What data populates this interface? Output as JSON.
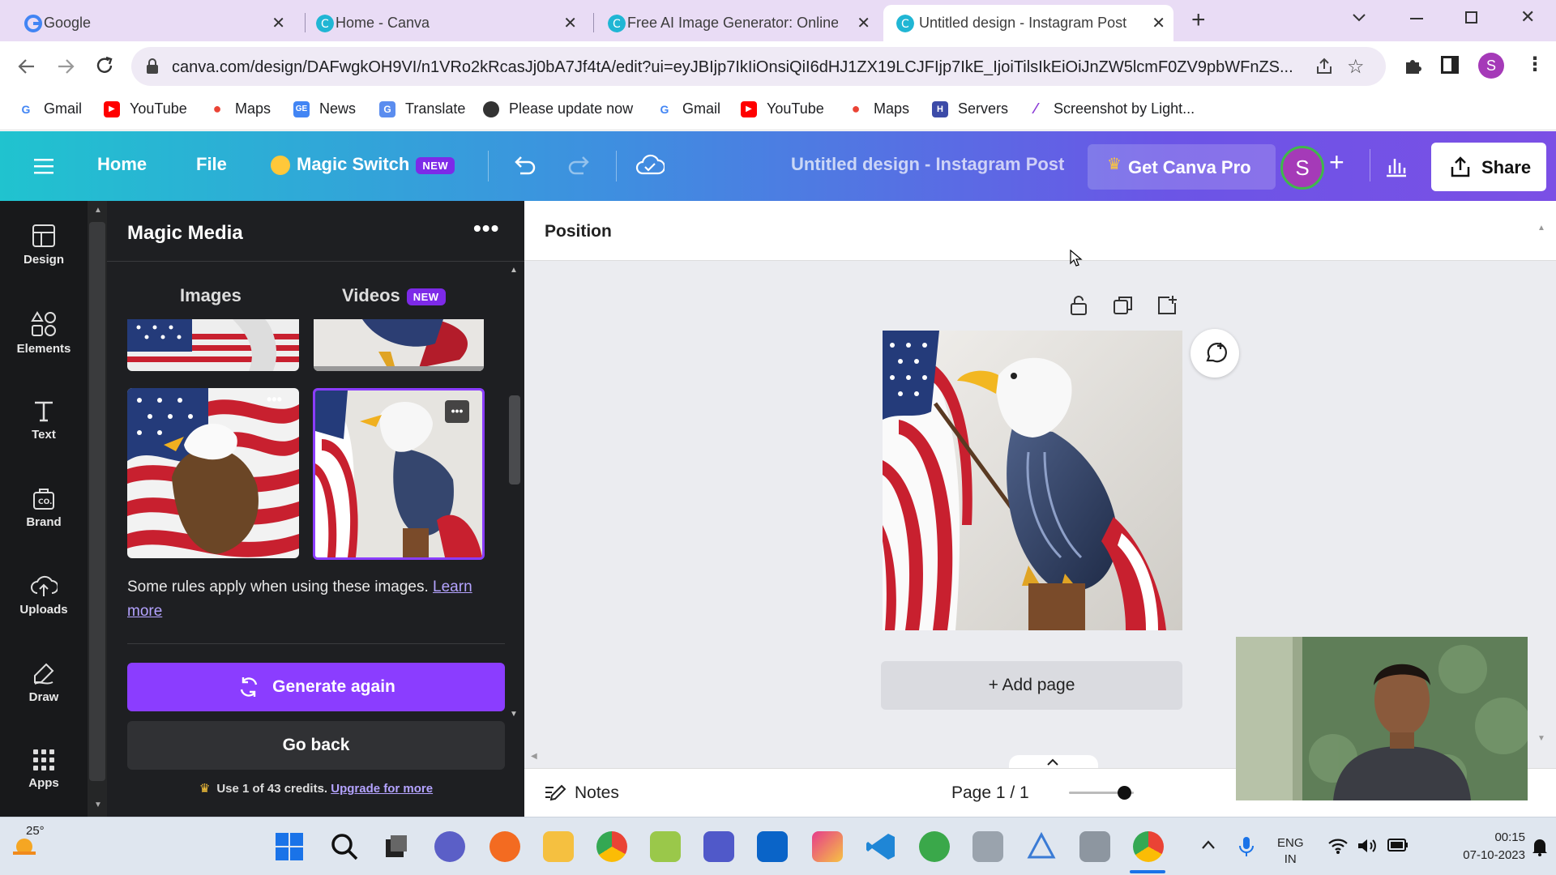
{
  "browser": {
    "tabs": [
      {
        "title": "Google",
        "active": false
      },
      {
        "title": "Home - Canva",
        "active": false
      },
      {
        "title": "Free AI Image Generator: Online",
        "active": false
      },
      {
        "title": "Untitled design - Instagram Post",
        "active": true
      }
    ],
    "url": "canva.com/design/DAFwgkOH9VI/n1VRo2kRcasJj0bA7Jf4tA/edit?ui=eyJBIjp7IkIiOnsiQiI6dHJ1ZX19LCJFIjp7IkE_IjoiTilsIkEiOiJnZW5lcmF0ZV9pbWFnZS...",
    "profile_initial": "S"
  },
  "bookmarks": [
    {
      "label": "Gmail",
      "icon": "google-icon"
    },
    {
      "label": "YouTube",
      "icon": "youtube-icon"
    },
    {
      "label": "Maps",
      "icon": "maps-pin-icon"
    },
    {
      "label": "News",
      "icon": "google-news-icon"
    },
    {
      "label": "Translate",
      "icon": "translate-icon"
    },
    {
      "label": "Please update now",
      "icon": "person-icon"
    },
    {
      "label": "Gmail",
      "icon": "google-icon"
    },
    {
      "label": "YouTube",
      "icon": "youtube-icon"
    },
    {
      "label": "Maps",
      "icon": "maps-pin-icon"
    },
    {
      "label": "Servers",
      "icon": "servers-icon"
    },
    {
      "label": "Screenshot by Light...",
      "icon": "feather-icon"
    }
  ],
  "canva_header": {
    "home": "Home",
    "file": "File",
    "magic_switch": "Magic Switch",
    "new_badge": "NEW",
    "doc_title": "Untitled design - Instagram Post",
    "get_pro": "Get Canva Pro",
    "avatar_initial": "S",
    "share": "Share"
  },
  "rail": [
    {
      "label": "Design",
      "icon": "design-layout-icon"
    },
    {
      "label": "Elements",
      "icon": "elements-shapes-icon"
    },
    {
      "label": "Text",
      "icon": "text-t-icon"
    },
    {
      "label": "Brand",
      "icon": "brand-bag-icon"
    },
    {
      "label": "Uploads",
      "icon": "cloud-upload-icon"
    },
    {
      "label": "Draw",
      "icon": "draw-pen-icon"
    },
    {
      "label": "Apps",
      "icon": "apps-grid-icon"
    }
  ],
  "panel": {
    "title": "Magic Media",
    "tab_images": "Images",
    "tab_videos": "Videos",
    "videos_badge": "NEW",
    "rules_text": "Some rules apply when using these images.",
    "rules_link": "Learn more",
    "generate_again": "Generate again",
    "go_back": "Go back",
    "credits_text": "Use 1 of 43 credits.",
    "credits_link": "Upgrade for more"
  },
  "workspace": {
    "position_label": "Position",
    "add_page": "+ Add page",
    "notes": "Notes",
    "page_indicator": "Page 1 / 1"
  },
  "taskbar": {
    "temperature": "25°",
    "lang_top": "ENG",
    "lang_bottom": "IN",
    "time": "00:15",
    "date": "07-10-2023"
  }
}
